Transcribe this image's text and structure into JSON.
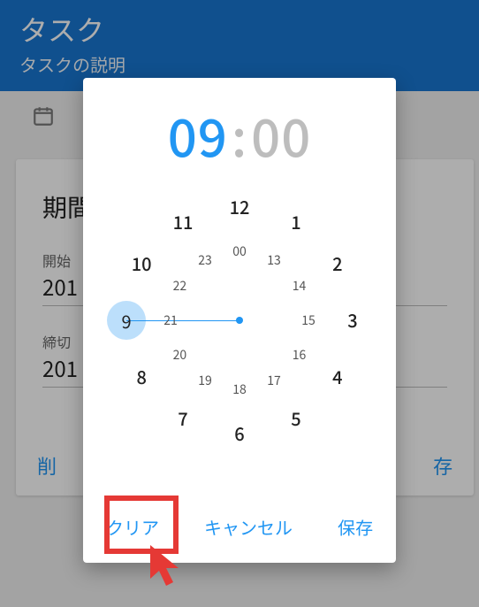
{
  "header": {
    "title": "タスク",
    "subtitle": "タスクの説明"
  },
  "background": {
    "section_title": "期間",
    "start_label": "開始",
    "start_value": "201",
    "due_label": "締切",
    "due_value": "201",
    "delete_label": "削",
    "save_label": "存"
  },
  "dialog": {
    "hour": "09",
    "minute": "00",
    "actions": {
      "clear": "クリア",
      "cancel": "キャンセル",
      "save": "保存"
    },
    "clock": {
      "outer": [
        "12",
        "1",
        "2",
        "3",
        "4",
        "5",
        "6",
        "7",
        "8",
        "9",
        "10",
        "11"
      ],
      "inner": [
        "00",
        "13",
        "14",
        "15",
        "16",
        "17",
        "18",
        "19",
        "20",
        "21",
        "22",
        "23"
      ],
      "selected_outer_index": 9
    }
  }
}
